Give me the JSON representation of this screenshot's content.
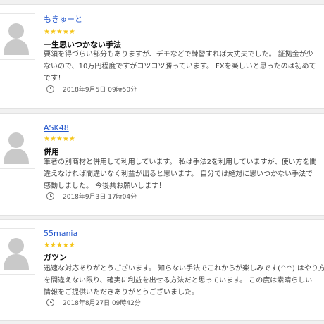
{
  "reviews": [
    {
      "author": "もきゅーと",
      "stars": "★★★★★",
      "title": "一生思いつかない手法",
      "body": [
        "要領を得づらい部分もありますが、デモなどで練習すれば大丈夫でした。 証拠金が少",
        "ないので、10万円程度ですがコツコツ勝っています。 FXを楽しいと思ったのは初めて",
        "です！"
      ],
      "date": "2018年9月5日 09時50分"
    },
    {
      "author": "ASK48",
      "stars": "★★★★★",
      "title": "併用",
      "body": [
        "筆者の別商材と併用して利用しています。 私は手法2を利用していますが、使い方を間",
        "違えなければ間違いなく利益が出ると思います。 自分では絶対に思いつかない手法で",
        "感動しました。 今後共お願いします！"
      ],
      "date": "2018年9月3日 17時04分"
    },
    {
      "author": "55mania",
      "stars": "★★★★★",
      "title": "ガツン",
      "body": [
        "迅速な対応ありがとうございます。 知らない手法でこれからが楽しみです(^^) はやり方",
        "を間違えない限り、確実に利益を出せる方法だと思っています。 この度は素晴らしい",
        "情報をご提供いただきありがとうございました。"
      ],
      "date": "2018年8月27日 09時42分"
    }
  ]
}
